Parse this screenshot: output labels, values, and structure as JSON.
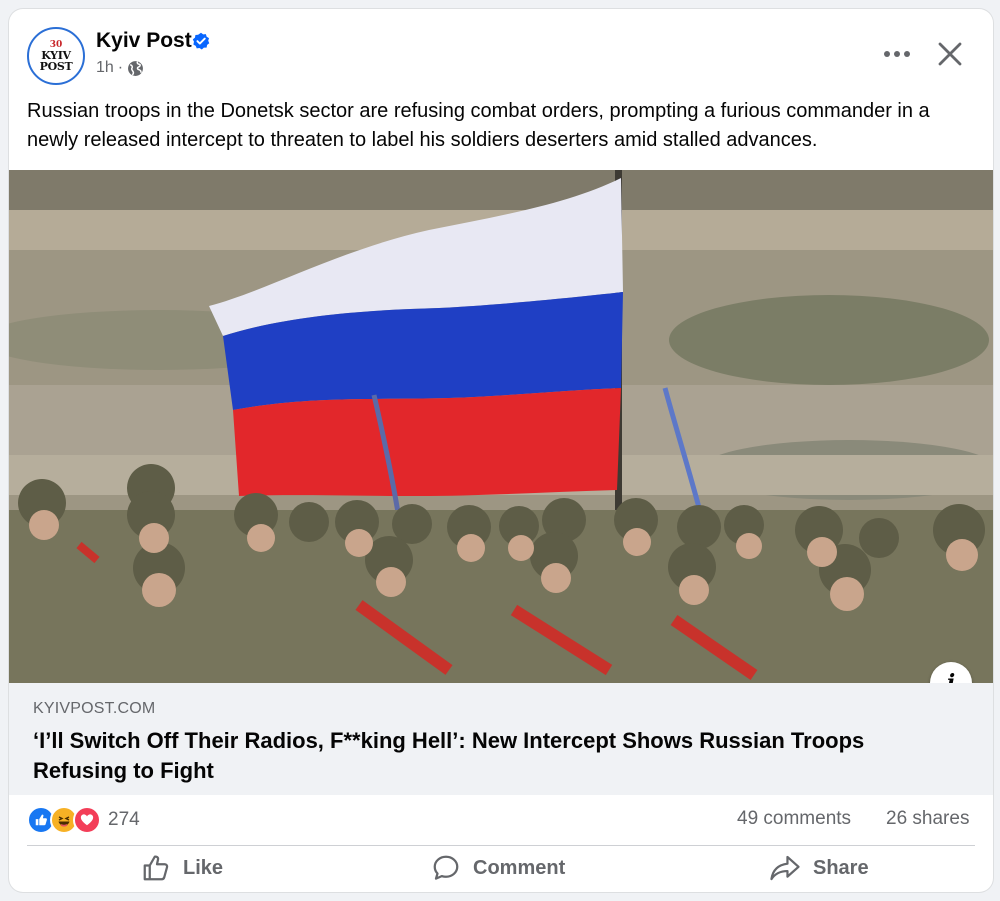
{
  "post": {
    "page_name": "Kyiv Post",
    "avatar_text": {
      "crest": "30",
      "line1": "KYIV",
      "line2": "POST"
    },
    "time": "1h",
    "separator": "·",
    "text": "Russian troops in the Donetsk sector are refusing combat orders, prompting a furious commander in a newly released intercept to threaten to label his soldiers deserters amid stalled advances.",
    "more_icon": "more-horizontal-icon",
    "close_icon": "close-icon"
  },
  "image": {
    "description_icon": "info-icon",
    "info_label": "i"
  },
  "link": {
    "domain": "KYIVPOST.COM",
    "title": "‘I’ll Switch Off Their Radios, F**king Hell’: New Intercept Shows Russian Troops Refusing to Fight"
  },
  "engagement": {
    "reaction_count": "274",
    "reactions": [
      "like",
      "haha",
      "love"
    ],
    "comments": "49 comments",
    "shares": "26 shares"
  },
  "actions": {
    "like": "Like",
    "comment": "Comment",
    "share": "Share"
  },
  "colors": {
    "verified_blue": "#0866ff",
    "like_blue": "#1877f2",
    "love_red": "#f33e58",
    "haha_yellow": "#f7b125",
    "flag_white": "#e9eaf2",
    "flag_blue": "#1c3fc9",
    "flag_red": "#e3262a"
  }
}
